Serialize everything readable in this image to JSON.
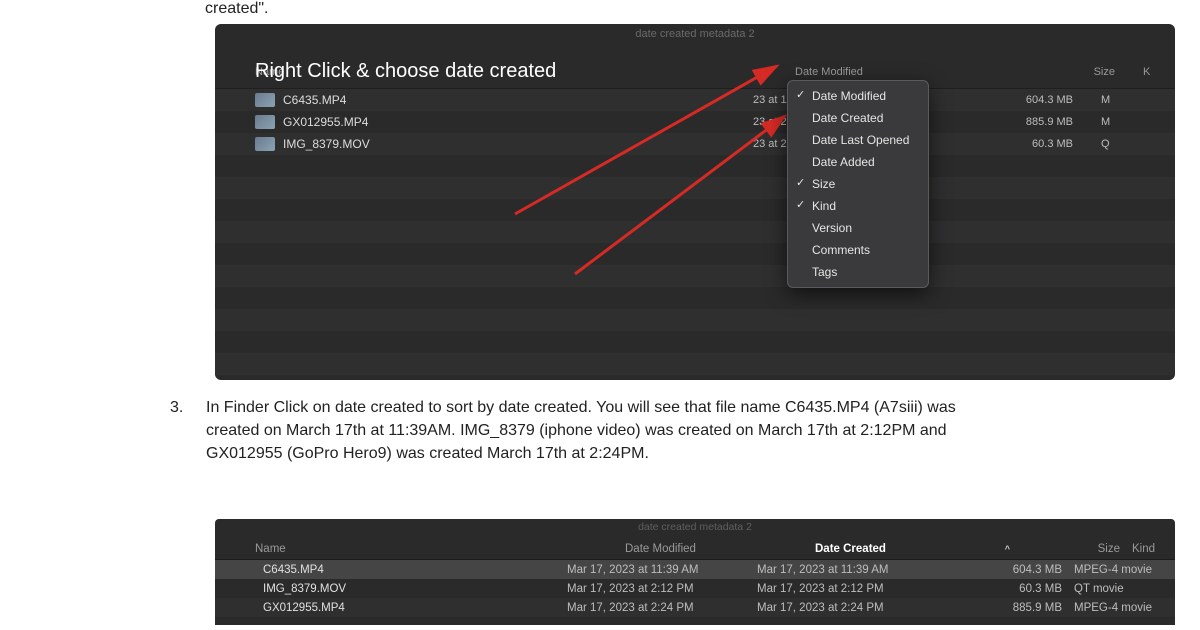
{
  "doc": {
    "top_fragment": "created\".",
    "step3_number": "3.",
    "step3_text": "In Finder Click on date created to sort by date created. You will see that file name C6435.MP4 (A7siii)  was created on March 17th at 11:39AM. IMG_8379 (iphone video) was created on March 17th at 2:12PM and GX012955 (GoPro Hero9)  was created March 17th at 2:24PM."
  },
  "annotation": {
    "text": "Right Click & choose date created"
  },
  "finder1": {
    "title": "date created metadata 2",
    "columns": {
      "name": "Name",
      "date_modified": "Date Modified",
      "size": "Size",
      "kind": "K"
    },
    "rows": [
      {
        "name": "C6435.MP4",
        "date": "23 at 11:39 AM",
        "size": "604.3 MB",
        "kind": "M"
      },
      {
        "name": "GX012955.MP4",
        "date": "23 at 2:24 PM",
        "size": "885.9 MB",
        "kind": "M"
      },
      {
        "name": "IMG_8379.MOV",
        "date": "23 at 2:12 PM",
        "size": "60.3 MB",
        "kind": "Q"
      }
    ],
    "context_menu": [
      {
        "label": "Date Modified",
        "checked": true
      },
      {
        "label": "Date Created",
        "checked": false
      },
      {
        "label": "Date Last Opened",
        "checked": false
      },
      {
        "label": "Date Added",
        "checked": false
      },
      {
        "label": "Size",
        "checked": true
      },
      {
        "label": "Kind",
        "checked": true
      },
      {
        "label": "Version",
        "checked": false
      },
      {
        "label": "Comments",
        "checked": false
      },
      {
        "label": "Tags",
        "checked": false
      }
    ]
  },
  "finder2": {
    "title": "date created metadata 2",
    "columns": {
      "name": "Name",
      "date_modified": "Date Modified",
      "date_created": "Date Created",
      "size": "Size",
      "kind": "Kind",
      "sort_caret": "^"
    },
    "rows": [
      {
        "name": "C6435.MP4",
        "dm": "Mar 17, 2023 at 11:39 AM",
        "dc": "Mar 17, 2023 at 11:39 AM",
        "size": "604.3 MB",
        "kind": "MPEG-4 movie",
        "selected": true
      },
      {
        "name": "IMG_8379.MOV",
        "dm": "Mar 17, 2023 at 2:12 PM",
        "dc": "Mar 17, 2023 at 2:12 PM",
        "size": "60.3 MB",
        "kind": "QT movie",
        "selected": false
      },
      {
        "name": "GX012955.MP4",
        "dm": "Mar 17, 2023 at 2:24 PM",
        "dc": "Mar 17, 2023 at 2:24 PM",
        "size": "885.9 MB",
        "kind": "MPEG-4 movie",
        "selected": false
      }
    ]
  }
}
